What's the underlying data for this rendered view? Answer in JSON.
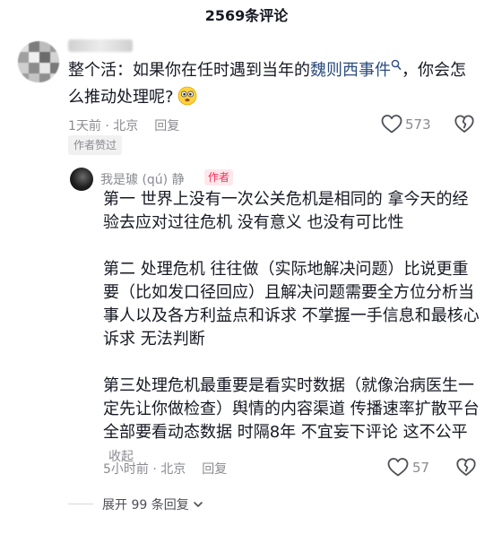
{
  "header": {
    "title": "2569条评论"
  },
  "top_comment": {
    "text_prefix": "整个活：如果你在任时遇到当年的",
    "link_text": "魏则西事件",
    "text_suffix": "，你会怎么推动处理呢?",
    "time_location": "1天前 · 北京",
    "reply_label": "回复",
    "like_count": "573",
    "author_liked_label": "作者赞过"
  },
  "reply": {
    "username": "我是璩 (qú) 静",
    "author_badge": "作者",
    "paragraphs": [
      "第一 世界上没有一次公关危机是相同的 拿今天的经验去应对过往危机 没有意义 也没有可比性",
      "第二  处理危机 往往做（实际地解决问题）比说更重要（比如发口径回应）且解决问题需要全方位分析当事人以及各方利益点和诉求 不掌握一手信息和最核心诉求 无法判断",
      "第三处理危机最重要是看实时数据（就像治病医生一定先让你做检查）舆情的内容渠道 传播速率扩散平台全部要看动态数据 时隔8年 不宜妄下评论 这不公平"
    ],
    "collapse_label": "收起",
    "time_location": "5小时前 · 北京",
    "reply_label": "回复",
    "like_count": "57"
  },
  "expand": {
    "label": "展开 99 条回复"
  },
  "icons": {
    "search": "search-icon",
    "emoji": "thinking-face-emoji",
    "like": "heart-outline-icon",
    "dislike": "broken-heart-icon",
    "expand": "chevron-down-icon"
  },
  "colors": {
    "link": "#2b4c7e",
    "accent": "#fe2c55",
    "muted": "#8a8b91"
  }
}
